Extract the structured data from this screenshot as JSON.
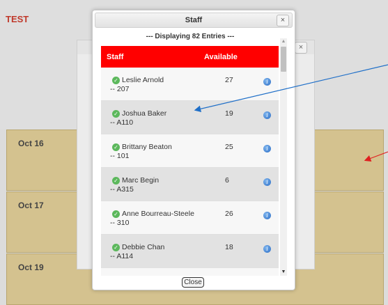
{
  "page": {
    "title": "TEST"
  },
  "days": [
    {
      "label": "Oct 16"
    },
    {
      "label": "Oct 17"
    },
    {
      "label": "Oct 19"
    }
  ],
  "background_dialog": {
    "close_label": "×"
  },
  "dialog": {
    "title": "Staff",
    "close_label": "×",
    "entries_text": "--- Displaying 82 Entries ---",
    "close_button_label": "Close"
  },
  "table": {
    "columns": [
      "Staff",
      "Available"
    ],
    "rows": [
      {
        "name": "Leslie Arnold",
        "room": "-- 207",
        "available": "27"
      },
      {
        "name": "Joshua Baker",
        "room": "-- A110",
        "available": "19"
      },
      {
        "name": "Brittany Beaton",
        "room": "-- 101",
        "available": "25"
      },
      {
        "name": "Marc Begin",
        "room": "-- A315",
        "available": "6"
      },
      {
        "name": "Anne Bourreau-Steele",
        "room": "-- 310",
        "available": "26"
      },
      {
        "name": "Debbie Chan",
        "room": "-- A114",
        "available": "18"
      }
    ]
  },
  "icons": {
    "status": "check-circle-icon",
    "info": "info-icon"
  },
  "colors": {
    "header_red": "#ff0000",
    "day_row": "#d4c28f",
    "title_red": "#c0392b",
    "arrow_blue": "#1f6fc8",
    "arrow_red": "#e02020"
  }
}
